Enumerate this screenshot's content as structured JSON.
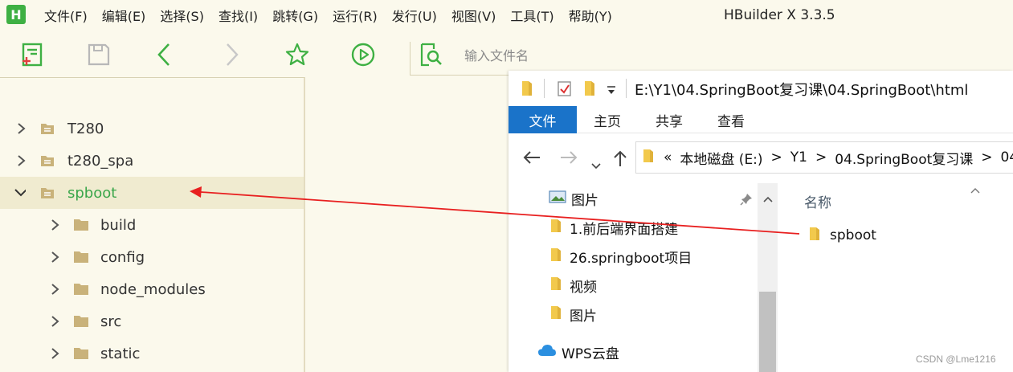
{
  "app": {
    "logo_letter": "H",
    "title": "HBuilder X 3.3.5"
  },
  "menu": [
    "文件(F)",
    "编辑(E)",
    "选择(S)",
    "查找(I)",
    "跳转(G)",
    "运行(R)",
    "发行(U)",
    "视图(V)",
    "工具(T)",
    "帮助(Y)"
  ],
  "toolbar": {
    "search_placeholder": "输入文件名",
    "icons": [
      "new-file-icon",
      "save-icon",
      "back-icon",
      "forward-icon",
      "favorite-star-icon",
      "run-icon",
      "file-search-icon"
    ]
  },
  "tree": {
    "items": [
      {
        "label": "T280",
        "expanded": false,
        "selected": false
      },
      {
        "label": "t280_spa",
        "expanded": false,
        "selected": false
      },
      {
        "label": "spboot",
        "expanded": true,
        "selected": true
      },
      {
        "label": "build",
        "expanded": false,
        "selected": false
      },
      {
        "label": "config",
        "expanded": false,
        "selected": false
      },
      {
        "label": "node_modules",
        "expanded": false,
        "selected": false
      },
      {
        "label": "src",
        "expanded": false,
        "selected": false
      },
      {
        "label": "static",
        "expanded": false,
        "selected": false
      }
    ]
  },
  "explorer": {
    "path": "E:\\Y1\\04.SpringBoot复习课\\04.SpringBoot\\html",
    "ribbon_tabs": [
      "文件",
      "主页",
      "共享",
      "查看"
    ],
    "address_crumbs": [
      "«",
      "本地磁盘 (E:)",
      ">",
      "Y1",
      ">",
      "04.SpringBoot复习课",
      ">",
      "04"
    ],
    "nav_items": [
      "图片",
      "1.前后端界面搭建",
      "26.springboot项目",
      "视频",
      "图片",
      "WPS云盘"
    ],
    "column_header": "名称",
    "files": [
      "spboot"
    ]
  },
  "colors": {
    "accent_green": "#3eb043",
    "selected_text": "#3aa64a",
    "folder_tan": "#c9b27a",
    "ribbon_blue": "#1a73c9",
    "arrow_red": "#e82020"
  },
  "watermark": "CSDN @Lme1216"
}
